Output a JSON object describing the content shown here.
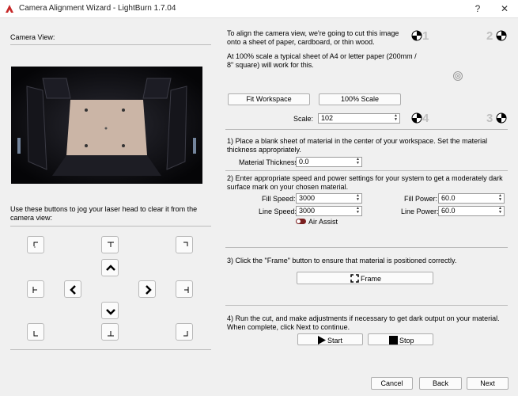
{
  "window": {
    "title": "Camera Alignment Wizard - LightBurn 1.7.04",
    "help_glyph": "?",
    "close_glyph": "✕"
  },
  "left": {
    "camera_view_label": "Camera View:",
    "jog_instructions": "Use these buttons to jog your laser head to clear it from the camera view:"
  },
  "right": {
    "intro": "To align the camera view, we're going to cut this image onto a sheet of paper, cardboard, or thin wood.",
    "scale_note": "At 100% scale a typical sheet of A4 or letter paper (200mm / 8\" square) will work for this.",
    "fit_workspace": "Fit Workspace",
    "scale_100": "100% Scale",
    "scale_label": "Scale:",
    "scale_value": "102",
    "markers": [
      "1",
      "2",
      "3",
      "4"
    ]
  },
  "step1": {
    "text": "1) Place a blank sheet of material in the center of your workspace. Set the material thickness appropriately.",
    "thickness_label": "Material Thickness:",
    "thickness_value": "0.0"
  },
  "step2": {
    "text": "2) Enter appropriate speed and power settings for your system to get a moderately dark surface mark on your chosen material.",
    "fill_speed_label": "Fill Speed:",
    "fill_speed": "3000",
    "line_speed_label": "Line Speed:",
    "line_speed": "3000",
    "fill_power_label": "Fill Power:",
    "fill_power": "60.0",
    "line_power_label": "Line Power:",
    "line_power": "60.0",
    "air_assist": "Air Assist"
  },
  "step3": {
    "text": "3) Click the \"Frame\" button to ensure that material is positioned correctly.",
    "frame": "Frame"
  },
  "step4": {
    "text": "4) Run the cut, and make adjustments if necessary to get dark output on your material. When complete, click Next to continue.",
    "start": "Start",
    "stop": "Stop"
  },
  "footer": {
    "cancel": "Cancel",
    "back": "Back",
    "next": "Next"
  }
}
